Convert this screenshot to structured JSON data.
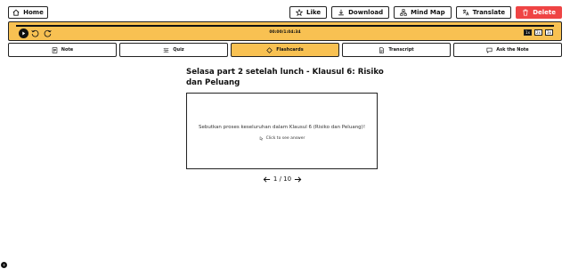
{
  "header": {
    "home_label": "Home",
    "actions": {
      "like": "Like",
      "download": "Download",
      "mind_map": "Mind Map",
      "translate": "Translate",
      "delete": "Delete"
    }
  },
  "player": {
    "time": "00:00/1:04:34",
    "speeds": [
      "1x",
      "2x",
      "3x"
    ],
    "active_speed": "1x",
    "progress": 0
  },
  "tabs": [
    {
      "label": "Note",
      "icon": "note-icon"
    },
    {
      "label": "Quiz",
      "icon": "quiz-icon"
    },
    {
      "label": "Flashcards",
      "icon": "flashcards-icon",
      "active": true
    },
    {
      "label": "Transcript",
      "icon": "transcript-icon"
    },
    {
      "label": "Ask the Note",
      "icon": "chat-icon"
    }
  ],
  "main": {
    "title": "Selasa part 2 setelah lunch - Klausul 6: Risiko dan Peluang",
    "card_question": "Sebutkan proses keseluruhan dalam Klausul 6 (Risiko dan Peluang)!",
    "card_hint": "Click to see answer",
    "pager": "1 / 10"
  },
  "colors": {
    "accent": "#f8c152",
    "delete": "#ef4444",
    "border": "#222222"
  }
}
